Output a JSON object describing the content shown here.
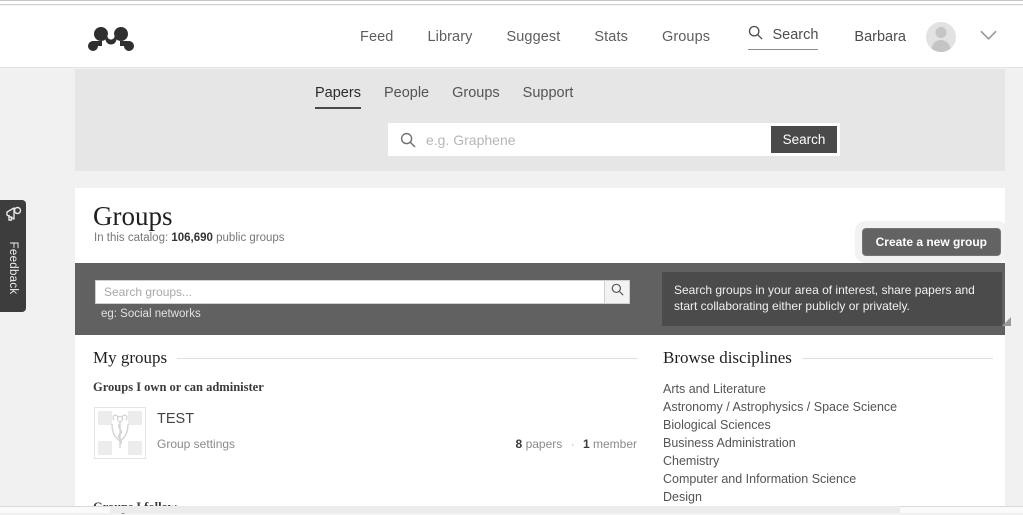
{
  "header": {
    "logo_icon": "mendeley-logo",
    "nav": [
      {
        "label": "Feed"
      },
      {
        "label": "Library"
      },
      {
        "label": "Suggest"
      },
      {
        "label": "Stats"
      },
      {
        "label": "Groups"
      }
    ],
    "search_icon": "search-icon",
    "search_label": "Search",
    "username": "Barbara",
    "avatar_icon": "user-avatar-icon",
    "caret_icon": "chevron-down-icon"
  },
  "search_strip": {
    "tabs": [
      {
        "label": "Papers",
        "active": true
      },
      {
        "label": "People",
        "active": false
      },
      {
        "label": "Groups",
        "active": false
      },
      {
        "label": "Support",
        "active": false
      }
    ],
    "input_icon": "search-icon",
    "input_value": "",
    "input_placeholder": "e.g. Graphene",
    "submit_label": "Search"
  },
  "page": {
    "title": "Groups",
    "catalog_prefix": "In this catalog:",
    "catalog_count": "106,690",
    "catalog_suffix": "public groups",
    "create_button": "Create a new group"
  },
  "group_search": {
    "input_value": "",
    "input_placeholder": "Search groups...",
    "go_icon": "search-icon",
    "example_text": "eg: Social networks",
    "callout": "Search groups in your area of interest, share papers and start collaborating either publicly or privately."
  },
  "my_groups": {
    "heading": "My groups",
    "subheading": "Groups I own or can administer",
    "items": [
      {
        "thumb_icon": "caduceus-medical-icon",
        "name": "TEST",
        "settings_link": "Group settings",
        "papers_count": "8",
        "papers_label": "papers",
        "separator": "·",
        "members_count": "1",
        "members_label": "member"
      }
    ],
    "follow_heading": "Groups I follow"
  },
  "browse_disciplines": {
    "heading": "Browse disciplines",
    "items": [
      {
        "label": "Arts and Literature"
      },
      {
        "label": "Astronomy / Astrophysics / Space Science"
      },
      {
        "label": "Biological Sciences"
      },
      {
        "label": "Business Administration"
      },
      {
        "label": "Chemistry"
      },
      {
        "label": "Computer and Information Science"
      },
      {
        "label": "Design"
      }
    ]
  },
  "feedback": {
    "icon": "megaphone-icon",
    "label": "Feedback"
  },
  "colors": {
    "page_bg": "#f1f1f1",
    "strip_bg": "#e6e6e6",
    "dark_band": "#616161",
    "callout_bg": "#4b4b4b",
    "button_dark": "#4a4a4a",
    "create_button": "#636363",
    "feedback_tab": "#3d3d3d"
  }
}
